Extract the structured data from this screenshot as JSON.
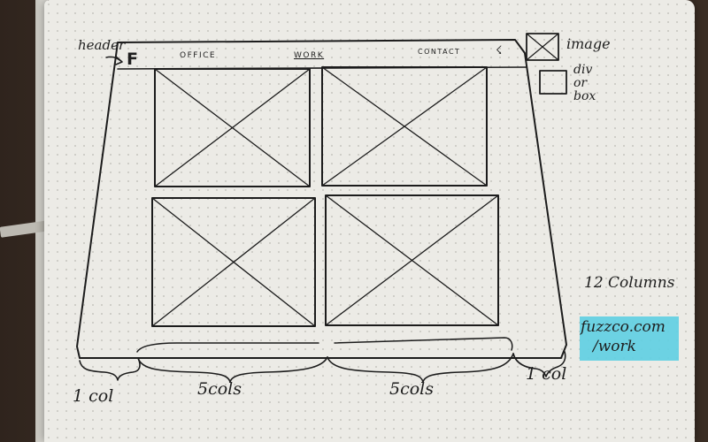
{
  "annotations": {
    "header": "header",
    "columns_note": "12 Columns",
    "url_line1": "fuzzco.com",
    "url_line2": "/work"
  },
  "header": {
    "logo": "F",
    "nav": [
      "OFFICE",
      "WORK",
      "CONTACT"
    ],
    "active_nav": "WORK",
    "user_icon": "user-icon"
  },
  "legend": {
    "image_label": "image",
    "box_label": "div or box"
  },
  "grid_labels": {
    "left": "1 col",
    "middle_left": "5cols",
    "middle_right": "5cols",
    "right": "1 col"
  },
  "colors": {
    "highlighter": "#5ecfe2",
    "ink": "#1c1c1c",
    "paper": "#ecebe6"
  }
}
